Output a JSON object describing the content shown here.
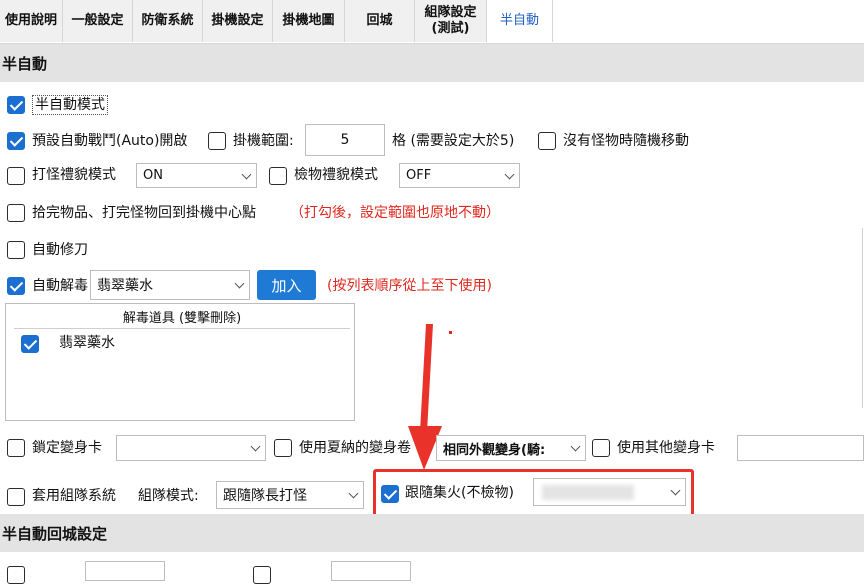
{
  "tabs": [
    {
      "label": "使用說明",
      "active": false
    },
    {
      "label": "一般設定",
      "active": false
    },
    {
      "label": "防衛系統",
      "active": false
    },
    {
      "label": "掛機設定",
      "active": false
    },
    {
      "label": "掛機地圖",
      "active": false
    },
    {
      "label": "回城",
      "active": false
    },
    {
      "label": "組隊設定\n(測試)",
      "active": false
    },
    {
      "label": "半自動",
      "active": true
    }
  ],
  "section1": {
    "title": "半自動"
  },
  "semi_auto_mode": {
    "label": "半自動模式",
    "checked": true
  },
  "default_auto_battle": {
    "label": "預設自動戰鬥(Auto)開啟",
    "checked": true
  },
  "idle_range": {
    "label": "掛機範圍:",
    "value": "5",
    "suffix": "格 (需要設定大於5)",
    "checked": false
  },
  "no_monster_random": {
    "label": "沒有怪物時隨機移動",
    "checked": false
  },
  "fight_courtesy": {
    "label": "打怪禮貌模式",
    "checked": false,
    "value": "ON"
  },
  "loot_courtesy": {
    "label": "檢物禮貌模式",
    "checked": false,
    "value": "OFF"
  },
  "return_center": {
    "label": "拾完物品、打完怪物回到掛機中心點",
    "note": "（打勾後，設定範圍也原地不動）",
    "checked": false
  },
  "auto_repair": {
    "label": "自動修刀",
    "checked": false
  },
  "auto_detox": {
    "label": "自動解毒",
    "checked": true,
    "select_value": "翡翠藥水",
    "add_button": "加入",
    "note": "(按列表順序從上至下使用)"
  },
  "detox_list": {
    "header": "解毒道具 (雙擊刪除)",
    "items": [
      {
        "label": "翡翠藥水",
        "checked": true
      }
    ]
  },
  "lock_transform": {
    "label": "鎖定變身卡",
    "checked": false,
    "value": ""
  },
  "use_xiana_transform": {
    "label": "使用夏納的變身卷",
    "checked": false,
    "select_value": "相同外觀變身(騎:"
  },
  "use_other_transform": {
    "label": "使用其他變身卡",
    "checked": false,
    "value": ""
  },
  "party_system": {
    "label": "套用組隊系統",
    "checked": false,
    "mode_label": "組隊模式:",
    "mode_value": "跟隨隊長打怪"
  },
  "follow_fire": {
    "label": "跟隨集火(不檢物)",
    "checked": true
  },
  "section2": {
    "title": "半自動回城設定"
  },
  "colors": {
    "accent": "#1b6fd0",
    "warning": "#e0281e",
    "highlight_box": "#e8322a"
  }
}
